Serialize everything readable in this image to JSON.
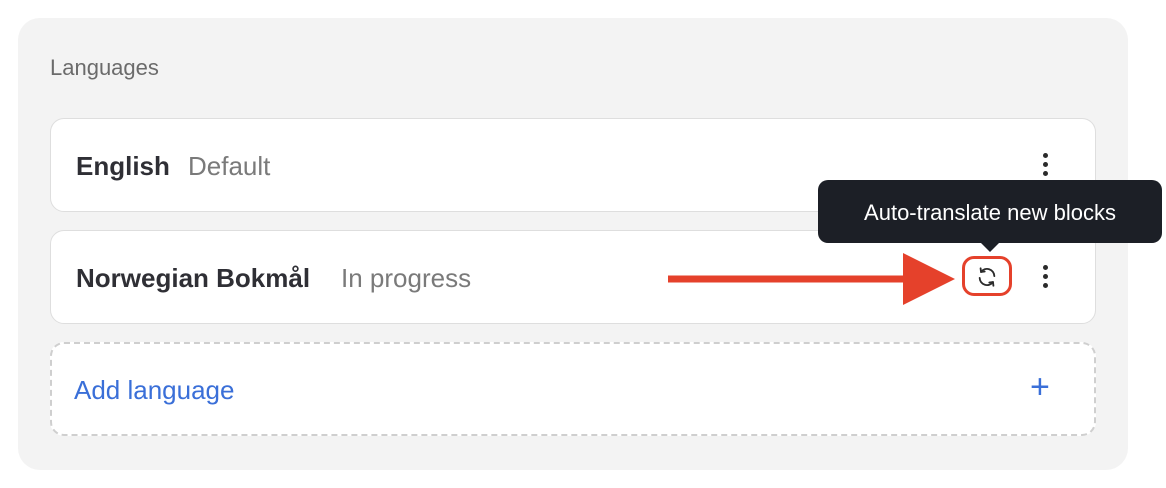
{
  "panel": {
    "title": "Languages"
  },
  "languages": [
    {
      "name": "English",
      "status": "Default"
    },
    {
      "name": "Norwegian Bokmål",
      "status": "In progress"
    }
  ],
  "add_language": {
    "label": "Add language",
    "plus": "+"
  },
  "tooltip": {
    "text": "Auto-translate new blocks"
  },
  "icons": {
    "sync": "sync-icon",
    "menu": "more-vertical-icon",
    "plus": "plus-icon"
  },
  "colors": {
    "accent_blue": "#3a6fd8",
    "annotation_red": "#e5412b",
    "tooltip_bg": "#1c1f26"
  }
}
